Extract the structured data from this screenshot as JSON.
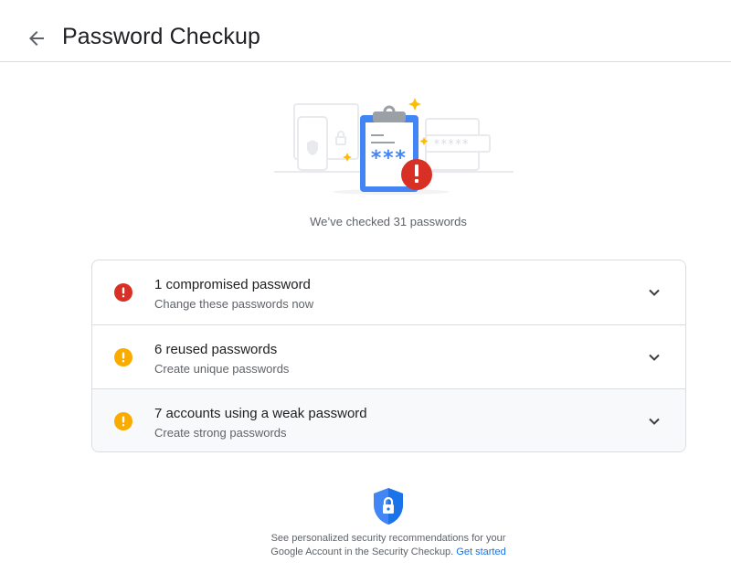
{
  "header": {
    "back_icon": "arrow-back-icon",
    "title": "Password Checkup"
  },
  "summary": {
    "checked_text": "We’ve checked 31 passwords"
  },
  "issues": [
    {
      "title": "1 compromised password",
      "subtitle": "Change these passwords now",
      "severity": "error",
      "icon": "error-icon",
      "icon_color": "#d93025"
    },
    {
      "title": "6 reused passwords",
      "subtitle": "Create unique passwords",
      "severity": "warning",
      "icon": "warning-icon",
      "icon_color": "#f9ab00"
    },
    {
      "title": "7 accounts using a weak password",
      "subtitle": "Create strong passwords",
      "severity": "warning",
      "icon": "warning-icon",
      "icon_color": "#f9ab00"
    }
  ],
  "footer": {
    "line1": "See personalized security recommendations for your",
    "line2": "Google Account in the Security Checkup.",
    "link": "Get started",
    "link_color": "#1a73e8"
  }
}
